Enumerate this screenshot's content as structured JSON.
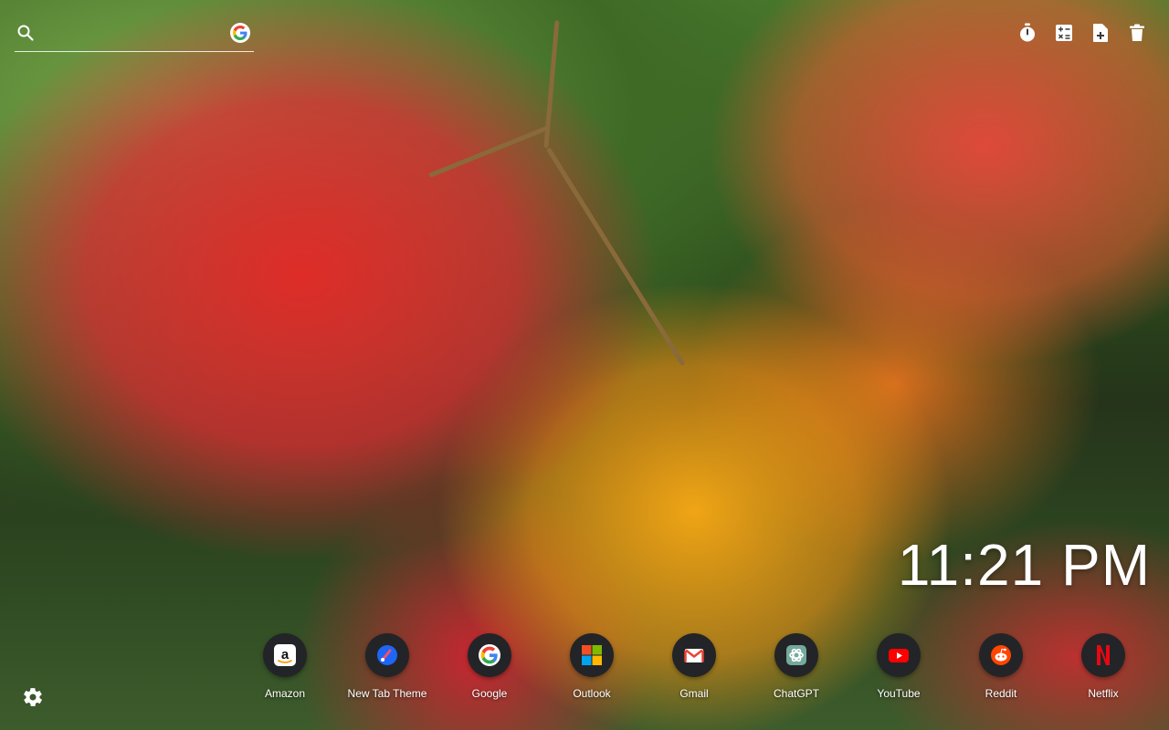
{
  "search": {
    "placeholder": "",
    "value": "",
    "engine_icon": "google-icon"
  },
  "toolbar": {
    "icons": [
      "timer-icon",
      "calculator-icon",
      "new-note-icon",
      "trash-icon"
    ]
  },
  "clock": {
    "time": "11:21 PM"
  },
  "shortcuts": [
    {
      "label": "Amazon",
      "icon": "amazon-icon"
    },
    {
      "label": "New Tab Theme",
      "icon": "new-tab-theme-icon"
    },
    {
      "label": "Google",
      "icon": "google-icon"
    },
    {
      "label": "Outlook",
      "icon": "outlook-icon"
    },
    {
      "label": "Gmail",
      "icon": "gmail-icon"
    },
    {
      "label": "ChatGPT",
      "icon": "chatgpt-icon"
    },
    {
      "label": "YouTube",
      "icon": "youtube-icon"
    },
    {
      "label": "Reddit",
      "icon": "reddit-icon"
    },
    {
      "label": "Netflix",
      "icon": "netflix-icon"
    }
  ],
  "footer": {
    "settings_icon": "gear-icon"
  },
  "colors": {
    "shortcut_bg": "#232427",
    "google_blue": "#4285F4",
    "google_red": "#EA4335",
    "google_yellow": "#FBBC05",
    "google_green": "#34A853",
    "youtube_red": "#FF0000",
    "reddit_orange": "#FF4500",
    "netflix_red": "#E50914"
  }
}
